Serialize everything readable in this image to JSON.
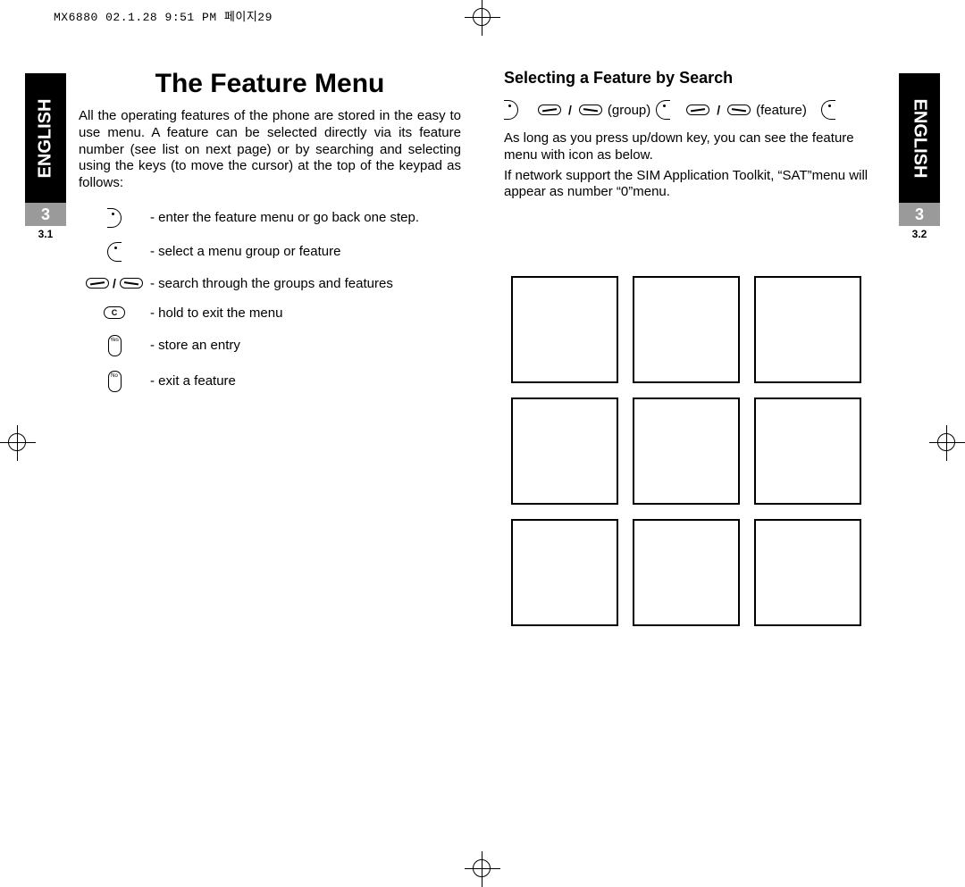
{
  "header_stamp": "MX6880 02.1.28 9:51 PM   페이지29",
  "language_label": "ENGLISH",
  "chapter_number": "3",
  "left": {
    "sub_section": "3.1",
    "title": "The Feature Menu",
    "intro": "All the operating features of the phone are stored in the easy to use menu. A feature can be selected directly via its feature number (see list on next page) or by searching and selecting using the keys (to move the cursor) at the top of the keypad as follows:",
    "keys": [
      {
        "icon": "side-left",
        "desc": "- enter the feature menu or go back one step."
      },
      {
        "icon": "side-right",
        "desc": "- select a menu group or feature"
      },
      {
        "icon": "up-down",
        "desc": "- search through the groups and features"
      },
      {
        "icon": "c",
        "desc": "- hold to exit the menu"
      },
      {
        "icon": "yes",
        "desc": "- store an entry"
      },
      {
        "icon": "no",
        "desc": "- exit a feature"
      }
    ]
  },
  "right": {
    "sub_section": "3.2",
    "subtitle": "Selecting a Feature by Search",
    "seq_group_label": "(group)",
    "seq_feature_label": "(feature)",
    "para1": "As long as you press up/down key, you can see the feature menu with icon as below.",
    "para2": "If network support the SIM Application Toolkit, “SAT”menu will appear as number “0”menu.",
    "grid_cells": 9
  },
  "icons": {
    "c_label": "C",
    "yes_label": "Yes",
    "no_label": "No"
  }
}
